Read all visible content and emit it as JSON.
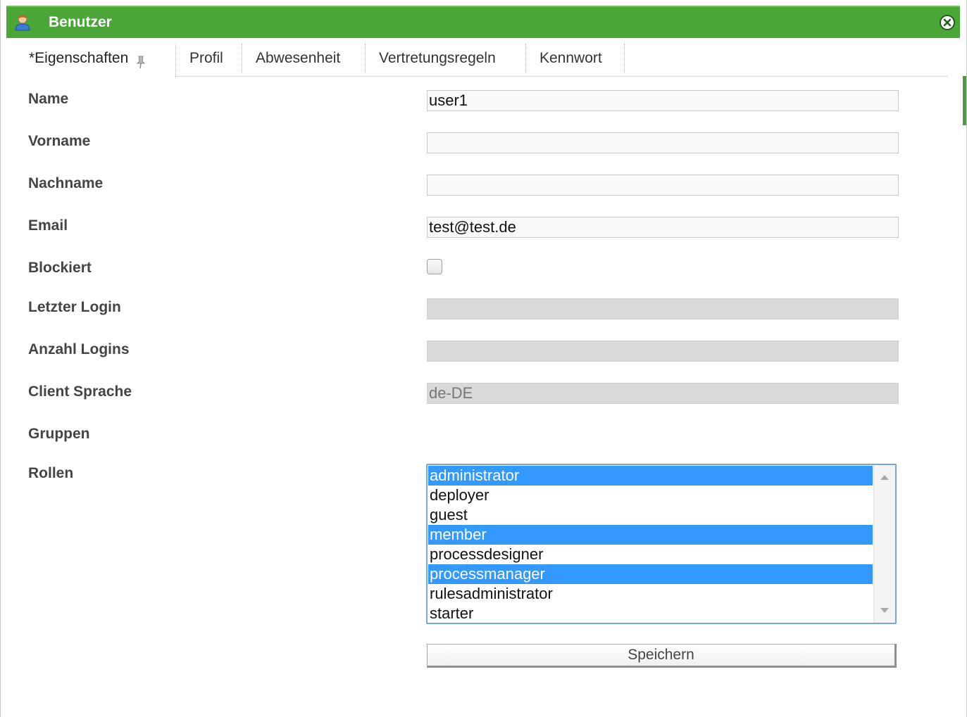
{
  "window": {
    "title": "Benutzer",
    "title_icon": "user-icon",
    "close_icon": "close-circle-icon",
    "accent_color": "#4aa637"
  },
  "tabs": [
    {
      "label": "*Eigenschaften",
      "active": true,
      "icon": "pin-icon"
    },
    {
      "label": "Profil",
      "active": false
    },
    {
      "label": "Abwesenheit",
      "active": false
    },
    {
      "label": "Vertretungsregeln",
      "active": false
    },
    {
      "label": "Kennwort",
      "active": false
    }
  ],
  "form": {
    "name": {
      "label": "Name",
      "value": "user1"
    },
    "vorname": {
      "label": "Vorname",
      "value": ""
    },
    "nachname": {
      "label": "Nachname",
      "value": ""
    },
    "email": {
      "label": "Email",
      "value": "test@test.de"
    },
    "blockiert": {
      "label": "Blockiert",
      "checked": false
    },
    "letzter_login": {
      "label": "Letzter Login",
      "value": ""
    },
    "anzahl_logins": {
      "label": "Anzahl Logins",
      "value": ""
    },
    "client_sprache": {
      "label": "Client Sprache",
      "value": "de-DE"
    },
    "gruppen": {
      "label": "Gruppen"
    },
    "rollen": {
      "label": "Rollen",
      "options": [
        {
          "label": "administrator",
          "selected": true
        },
        {
          "label": "deployer",
          "selected": false
        },
        {
          "label": "guest",
          "selected": false
        },
        {
          "label": "member",
          "selected": true
        },
        {
          "label": "processdesigner",
          "selected": false
        },
        {
          "label": "processmanager",
          "selected": true
        },
        {
          "label": "rulesadministrator",
          "selected": false
        },
        {
          "label": "starter",
          "selected": false
        }
      ],
      "selection_color": "#3399ff"
    }
  },
  "actions": {
    "save_label": "Speichern"
  }
}
